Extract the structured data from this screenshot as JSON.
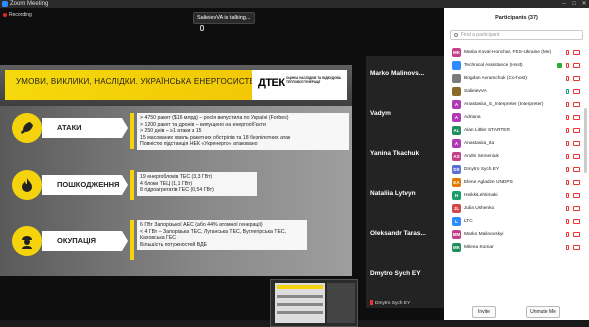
{
  "window": {
    "title": "Zoom Meeting",
    "minimize": "–",
    "maximize": "□",
    "close": "✕"
  },
  "meeting": {
    "recording_label": "Recording",
    "talking": "SalieievVA is talking..."
  },
  "slide": {
    "headline": "УМОВИ, ВИКЛИКИ, НАСЛІДКИ. УКРАЇНСЬКА ЕНЕРГОСИСТЕМА",
    "logo": "ДТЕК",
    "logo_sub": "ОЦІНКА НАСЛІДКІВ ТА ВІДБУДОВА ТЕПЛОВОЇ ГЕНЕРАЦІЇ",
    "sections": [
      {
        "label": "АТАКИ",
        "icon": "rocket-icon",
        "bullets": [
          "> 4750 ракет ($16 млрд) – росія випустила по Україні (Forbes)",
          "> 1200 ракет та дронів – випущено на енергооб'єкти",
          "> 250 днів – ≥1 атаки з 15",
          "15 масованих хвиль ракетних обстрілів та 18 безпілотних атак",
          "Повністю підстанція НЕК «Укренерго» атаковано"
        ]
      },
      {
        "label": "ПОШКОДЖЕННЯ",
        "icon": "fire-icon",
        "bullets": [
          "19 енергоблоків ТЕС (3,3 ГВт)",
          "4 блоки ТЕЦ (1,1 ГВт)",
          "8 гідроагрегатів ГЕС (0,54 ГВт)"
        ]
      },
      {
        "label": "ОКУПАЦІЯ",
        "icon": "soldier-icon",
        "bullets": [
          "6 ГВт Запорізької АЕС (або 44% атомної генерації)",
          "< 4 ГВт – Запорізька ТЕС, Луганська ТЕС, Вуглегірська ТЕС,",
          "Каховська ГЕС",
          "Більшість потужностей ВДЕ"
        ]
      }
    ]
  },
  "video_tiles": [
    {
      "name": "Marko  Malinovs...",
      "small": "Marko Malinovskyi"
    },
    {
      "name": "Vadym",
      "small": "Vadym"
    },
    {
      "name": "Yanina Tkachuk",
      "small": "Yanina Tkachuk"
    },
    {
      "name": "Nataliia Lytvyn",
      "small": "Nataliia Lytvyn"
    },
    {
      "name": "Oleksandr  Taras...",
      "small": "Oleksandr Tarasenko"
    },
    {
      "name": "Dmytro Sych EY",
      "small": "Dmytro Sych EY"
    }
  ],
  "participants_panel": {
    "title": "Participants (37)",
    "search_placeholder": "Find a participant",
    "invite": "Invite",
    "unmute_me": "Unmute Me",
    "items": [
      {
        "initials": "MK",
        "color": "#c2418a",
        "name": "Mariia Koval-Honchar, FES-Ukraine (Me)"
      },
      {
        "initials": "",
        "color": "#2d8cff",
        "name": "Technical Assistance (Host)"
      },
      {
        "initials": "",
        "color": "#7b7b7b",
        "name": "Bogdan Avramchuk (Co-host)"
      },
      {
        "initials": "",
        "color": "#8a6a2a",
        "name": "SalieievVA"
      },
      {
        "initials": "A",
        "color": "#b03ab5",
        "name": "Anastasiia_S_Interpreter (Interpreter)"
      },
      {
        "initials": "A",
        "color": "#b03ab5",
        "name": "Adriana"
      },
      {
        "initials": "AL",
        "color": "#1e8f5a",
        "name": "Alan Littler STARTER"
      },
      {
        "initials": "A",
        "color": "#b03ab5",
        "name": "Anastasiia_Ita"
      },
      {
        "initials": "AS",
        "color": "#c2418a",
        "name": "Andrii Semeniuk"
      },
      {
        "initials": "DS",
        "color": "#5a6fd6",
        "name": "Dmytro Sych EY"
      },
      {
        "initials": "EA",
        "color": "#e07b00",
        "name": "Elene Agladze UNDPS"
      },
      {
        "initials": "H",
        "color": "#1a9e6b",
        "name": "HeikkiLehtimaki"
      },
      {
        "initials": "JL",
        "color": "#d04a4a",
        "name": "Julia Ushenko"
      },
      {
        "initials": "L",
        "color": "#2d8cff",
        "name": "LTC"
      },
      {
        "initials": "MM",
        "color": "#c2418a",
        "name": "Marko Malinovskyi"
      },
      {
        "initials": "MK",
        "color": "#1e8f5a",
        "name": "Milena Komar"
      }
    ]
  }
}
